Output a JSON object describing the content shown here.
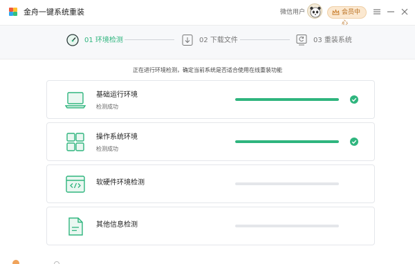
{
  "app": {
    "title": "金舟一键系统重装",
    "user_name": "微信用户",
    "vip_label": "会员中心"
  },
  "steps": [
    {
      "label": "01 环境检测",
      "state": "active"
    },
    {
      "label": "02 下载文件",
      "state": "pending"
    },
    {
      "label": "03 重装系统",
      "state": "pending"
    }
  ],
  "main": {
    "subtitle": "正在进行环境检测，确定当前系统是否适合使用在线重装功能",
    "checks": [
      {
        "title": "基础运行环境",
        "status": "检测成功",
        "progress": 1.0,
        "done": true,
        "icon": "laptop-icon"
      },
      {
        "title": "操作系统环境",
        "status": "检测成功",
        "progress": 1.0,
        "done": true,
        "icon": "windows-grid-icon"
      },
      {
        "title": "软硬件环境检测",
        "status": "",
        "progress": 0,
        "done": false,
        "icon": "code-window-icon"
      },
      {
        "title": "其他信息检测",
        "status": "",
        "progress": 0,
        "done": false,
        "icon": "document-icon"
      }
    ]
  },
  "colors": {
    "accent": "#2fb57e",
    "track": "#e4e6ea",
    "vip": "#b86d1c"
  }
}
